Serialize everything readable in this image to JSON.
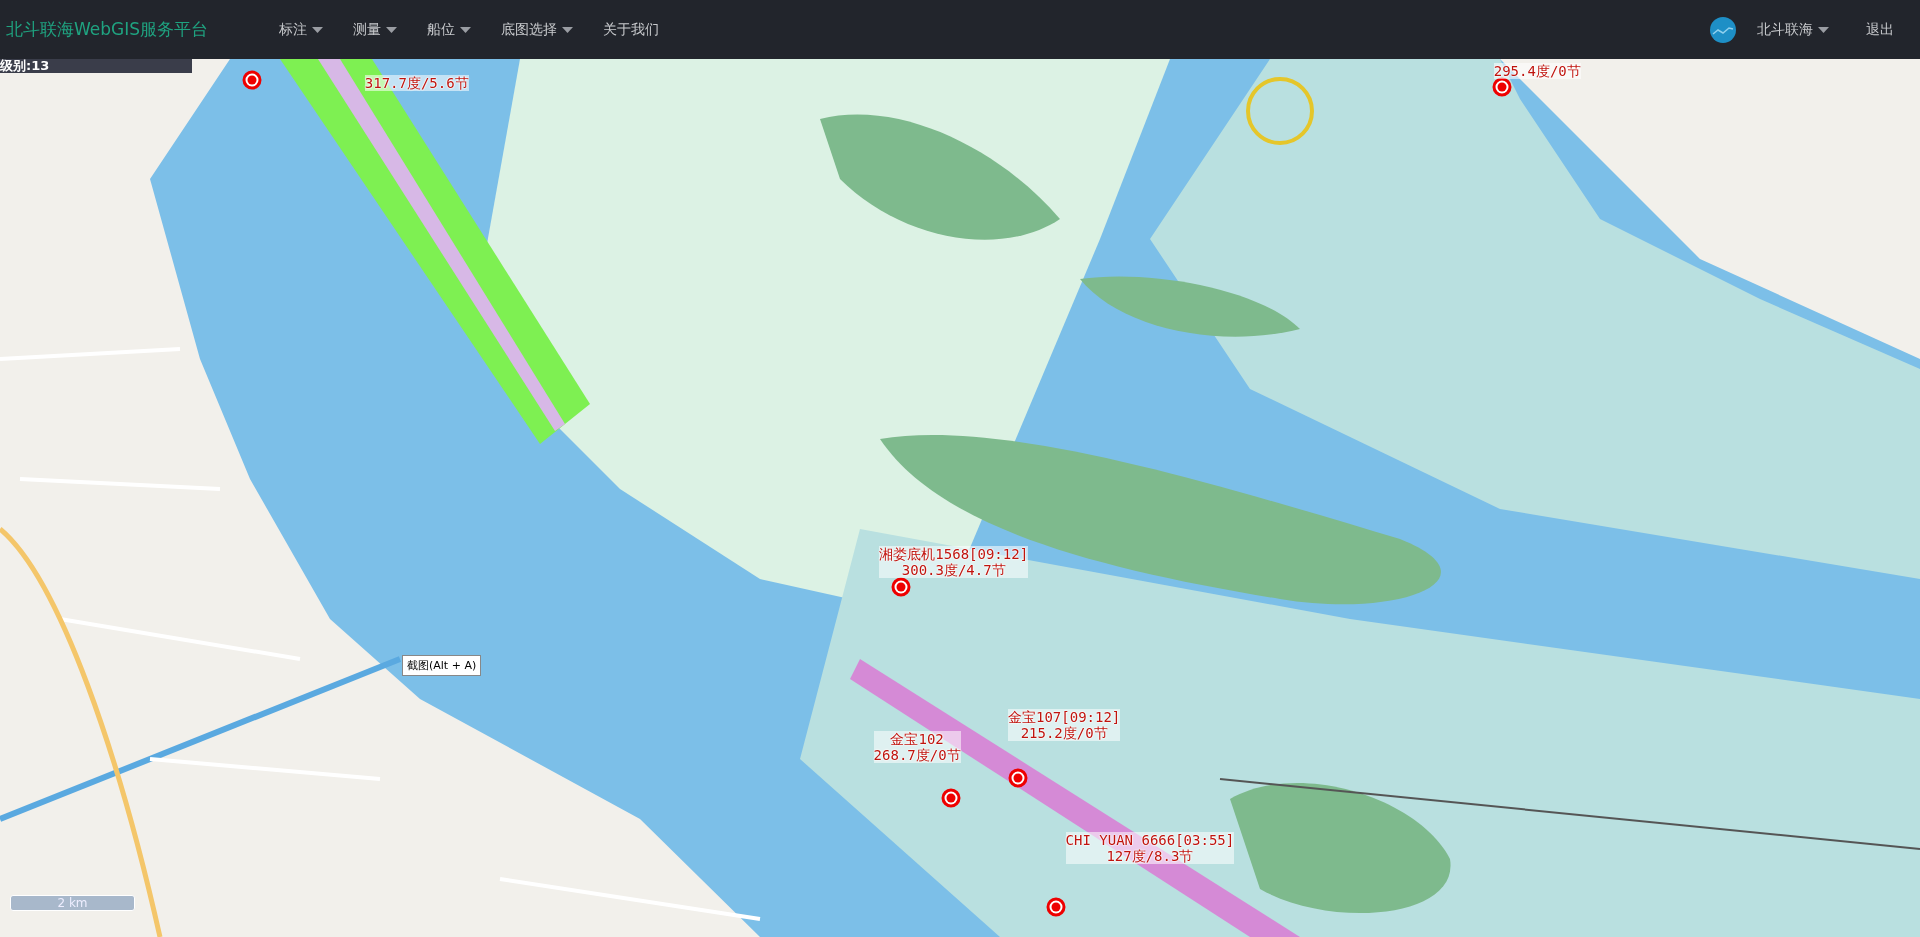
{
  "navbar": {
    "brand": "北斗联海WebGIS服务平台",
    "menus": [
      {
        "label": "标注",
        "dropdown": true
      },
      {
        "label": "测量",
        "dropdown": true
      },
      {
        "label": "船位",
        "dropdown": true
      },
      {
        "label": "底图选择",
        "dropdown": true
      },
      {
        "label": "关于我们",
        "dropdown": false
      }
    ],
    "user": {
      "name": "北斗联海",
      "dropdown": true
    },
    "logout": "退出"
  },
  "map": {
    "zoom_level": "级别:13",
    "ships": [
      {
        "lines": [
          "317.7度/5.6节"
        ]
      },
      {
        "lines": [
          "295.4度/0节"
        ]
      },
      {
        "lines": [
          "湘娄底机1568[09:12]",
          "300.3度/4.7节"
        ]
      },
      {
        "lines": [
          "金宝107[09:12]",
          "215.2度/0节"
        ]
      },
      {
        "lines": [
          "金宝102",
          "268.7度/0节"
        ]
      },
      {
        "lines": [
          "CHI YUAN 6666[03:55]",
          "127度/8.3节"
        ]
      }
    ],
    "tooltip": "截图(Alt + A)",
    "scale": "2 km"
  }
}
